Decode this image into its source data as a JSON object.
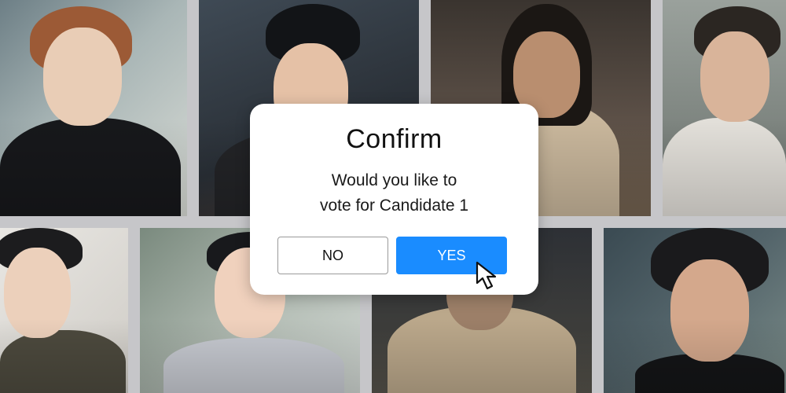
{
  "dialog": {
    "title": "Confirm",
    "message_line1": "Would you like to",
    "message_line2": "vote for Candidate 1",
    "no_label": "NO",
    "yes_label": "YES"
  },
  "colors": {
    "yes_button": "#1a8cff",
    "no_button_border": "#9a9a9a",
    "dialog_background": "#ffffff"
  },
  "icons": {
    "cursor": "mouse-pointer-icon"
  }
}
